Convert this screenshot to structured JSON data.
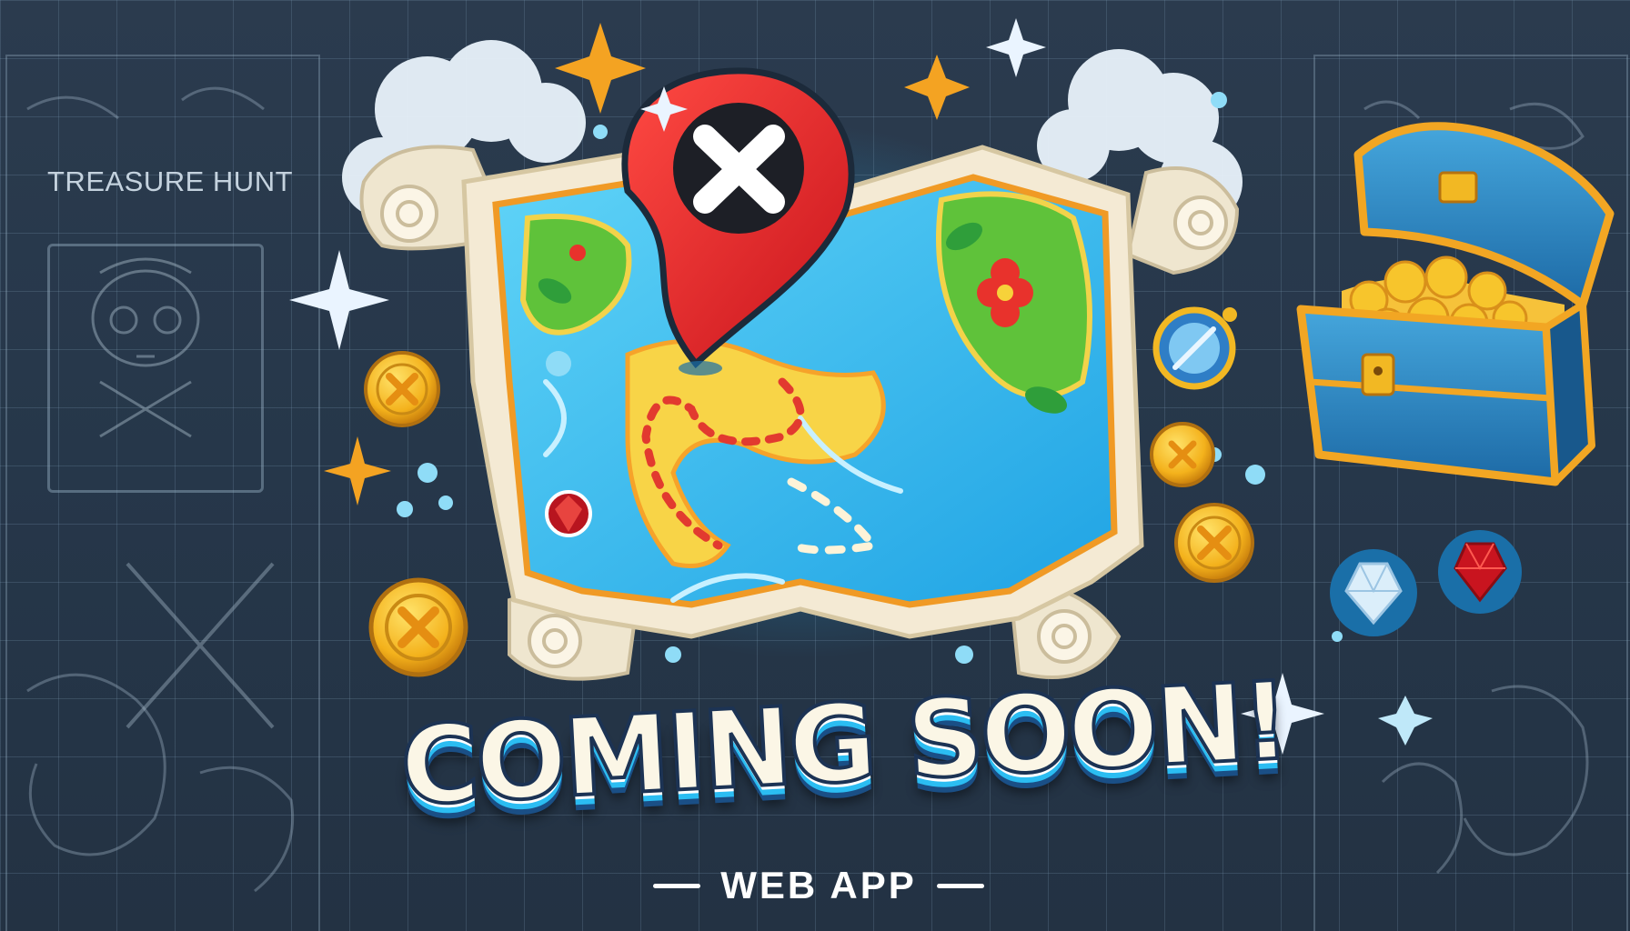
{
  "side_label": "TREASURE HUNT",
  "headline": "COMING SOON!",
  "subtitle": "WEB APP",
  "icons": [
    "map-pin-x-icon",
    "treasure-map",
    "treasure-chest",
    "gold-coin-x-icon",
    "compass-icon",
    "gem-icon",
    "sparkle-icon",
    "skull-icon"
  ],
  "colors": {
    "background": "#26374a",
    "accent_blue": "#2bbdf2",
    "pin_red": "#e8262b",
    "gold": "#f2b823",
    "parchment": "#f4ead4"
  }
}
